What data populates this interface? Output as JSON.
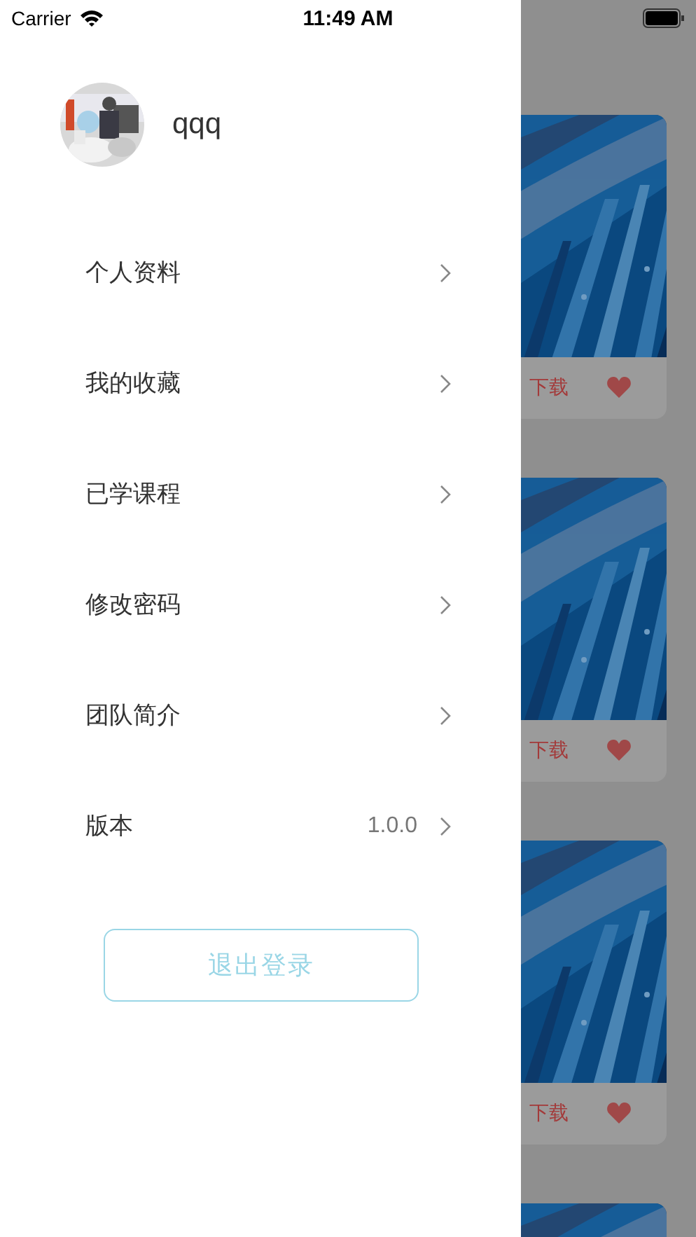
{
  "status_bar": {
    "carrier": "Carrier",
    "time": "11:49 AM"
  },
  "drawer": {
    "user": {
      "name": "qqq",
      "avatar": {
        "kind": "picture"
      }
    },
    "menu": [
      {
        "label": "个人资料"
      },
      {
        "label": "我的收藏"
      },
      {
        "label": "已学课程"
      },
      {
        "label": "修改密码"
      },
      {
        "label": "团队简介"
      },
      {
        "label": "版本",
        "value": "1.0.0"
      }
    ],
    "logout_button": "退出登录"
  },
  "background_cards": [
    {
      "kind": "picture",
      "action": "下载"
    },
    {
      "kind": "picture",
      "action": "下载"
    },
    {
      "kind": "picture",
      "action": "下载"
    },
    {
      "kind": "picture"
    }
  ]
}
